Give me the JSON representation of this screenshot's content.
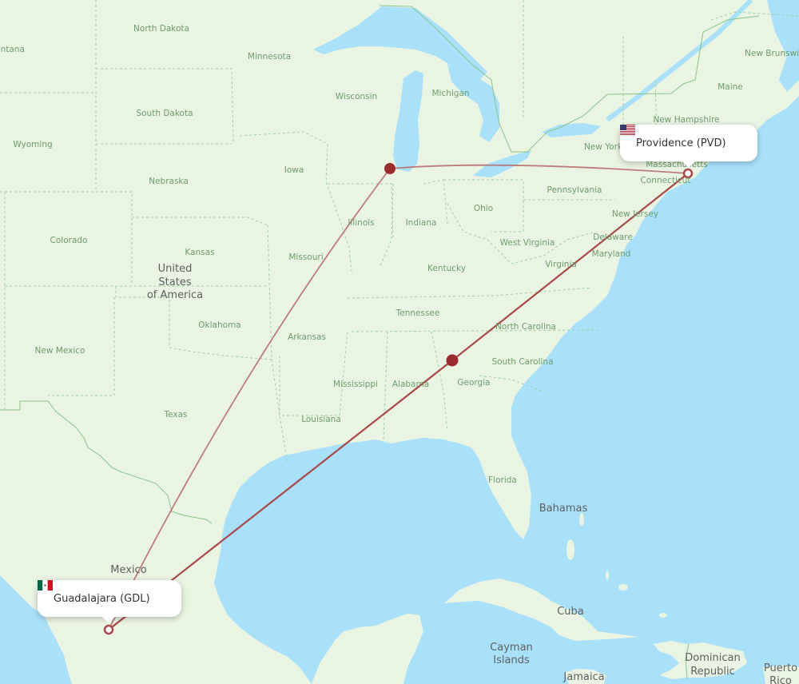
{
  "map": {
    "colors": {
      "water": "#a9e0fa",
      "land": "#eaf4e2",
      "land_shade": "#dcebd2",
      "border_state": "#9fcf9f",
      "border_country": "#88c488",
      "route": "#a84848",
      "marker": "#9b2a2e"
    },
    "country_labels": [
      {
        "name": "united-states-label",
        "lines": [
          "United",
          "States",
          "of America"
        ]
      },
      {
        "name": "mexico-label",
        "text": "Mexico"
      },
      {
        "name": "bahamas-label",
        "text": "Bahamas"
      },
      {
        "name": "cuba-label",
        "text": "Cuba"
      },
      {
        "name": "cayman-islands-label",
        "lines": [
          "Cayman",
          "Islands"
        ]
      },
      {
        "name": "jamaica-label",
        "text": "Jamaica"
      },
      {
        "name": "dominican-republic-label",
        "lines": [
          "Dominican",
          "Republic"
        ]
      },
      {
        "name": "puerto-rico-label",
        "lines": [
          "Puerto",
          "Rico"
        ]
      }
    ],
    "state_labels": [
      "North Dakota",
      "Montana",
      "Minnesota",
      "South Dakota",
      "Wisconsin",
      "Michigan",
      "Wyoming",
      "Iowa",
      "Nebraska",
      "Illinois",
      "Indiana",
      "Ohio",
      "Pennsylvania",
      "New York",
      "New Hampshire",
      "Maine",
      "New Brunswick",
      "Massachusetts",
      "Connecticut",
      "New Jersey",
      "Delaware",
      "Maryland",
      "West Virginia",
      "Virginia",
      "Kentucky",
      "Colorado",
      "Kansas",
      "Missouri",
      "Oklahoma",
      "Arkansas",
      "Tennessee",
      "North Carolina",
      "South Carolina",
      "Georgia",
      "Alabama",
      "Mississippi",
      "Louisiana",
      "Texas",
      "New Mexico",
      "Florida"
    ]
  },
  "routes": [
    {
      "from": "GDL",
      "via": "Chicago",
      "to": "PVD"
    },
    {
      "from": "GDL",
      "via": "Atlanta",
      "to": "PVD"
    }
  ],
  "origin": {
    "city": "Guadalajara",
    "code": "GDL",
    "label": "Guadalajara (GDL)",
    "flag": "mexico-flag-icon"
  },
  "destination": {
    "city": "Providence",
    "code": "PVD",
    "label": "Providence (PVD)",
    "flag": "usa-flag-icon"
  },
  "stopovers": [
    {
      "name": "chicago-stopover"
    },
    {
      "name": "atlanta-stopover"
    }
  ]
}
